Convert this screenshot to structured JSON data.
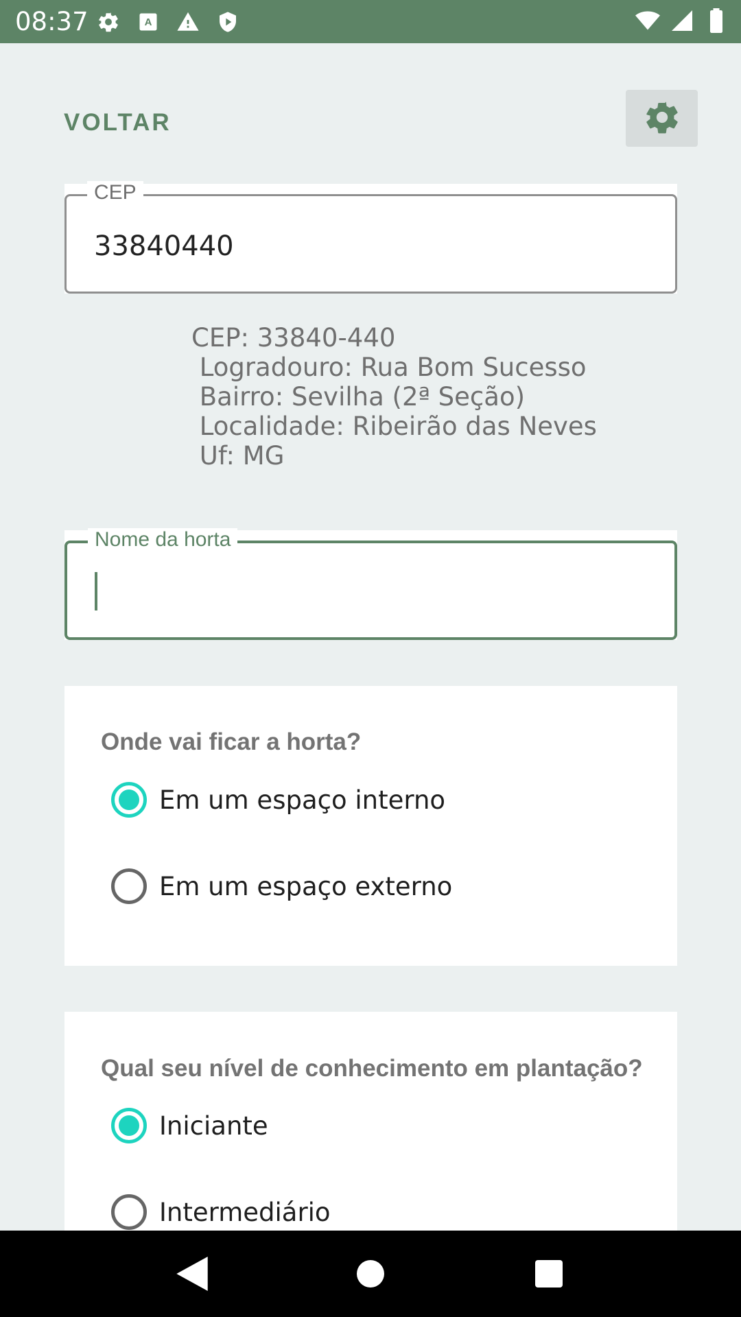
{
  "status_bar": {
    "time": "08:37",
    "icons_left": [
      "gear-icon",
      "keyboard-a-icon",
      "warning-icon",
      "shield-play-icon"
    ],
    "icons_right": [
      "wifi-icon",
      "signal-icon",
      "battery-icon"
    ]
  },
  "header": {
    "back_label": "VOLTAR",
    "settings_icon": "gear-icon"
  },
  "cep_field": {
    "label": "CEP",
    "value": "33840440"
  },
  "address_info": {
    "text": "CEP: 33840-440\n Logradouro: Rua Bom Sucesso\n Bairro: Sevilha (2ª Seção)\n Localidade: Ribeirão das Neves\n Uf: MG"
  },
  "nome_field": {
    "label": "Nome da horta",
    "value": ""
  },
  "location_question": {
    "title": "Onde vai ficar a horta?",
    "options": [
      {
        "label": "Em um espaço interno",
        "checked": true
      },
      {
        "label": "Em um espaço externo",
        "checked": false
      }
    ]
  },
  "knowledge_question": {
    "title": "Qual seu nível de conhecimento em plantação?",
    "options": [
      {
        "label": "Iniciante",
        "checked": true
      },
      {
        "label": "Intermediário",
        "checked": false
      }
    ]
  },
  "nav_bar": {
    "buttons": [
      "back-triangle-icon",
      "home-circle-icon",
      "recents-square-icon"
    ]
  },
  "colors": {
    "primary": "#5d8466",
    "accent": "#1dd4bf",
    "background": "#ebf0f0"
  }
}
